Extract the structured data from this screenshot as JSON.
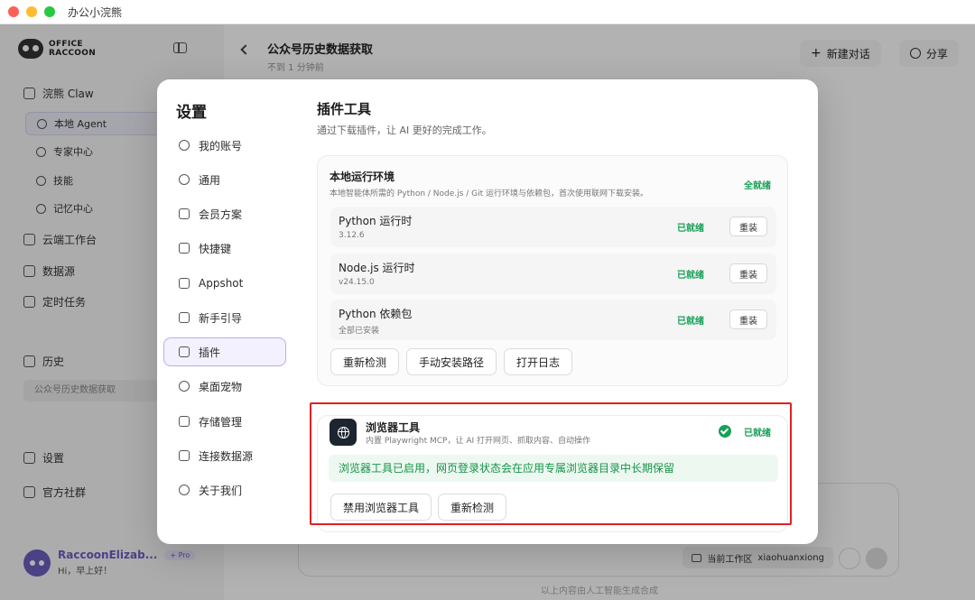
{
  "app": {
    "title": "办公小浣熊"
  },
  "sidebar": {
    "logo_line1": "OFFICE",
    "logo_line2": "RACCOON",
    "items": [
      {
        "label": "浣熊 Claw"
      },
      {
        "label": "本地 Agent"
      },
      {
        "label": "专家中心"
      },
      {
        "label": "技能"
      },
      {
        "label": "记忆中心"
      },
      {
        "label": "云端工作台"
      },
      {
        "label": "数据源"
      },
      {
        "label": "定时任务"
      },
      {
        "label": "历史"
      },
      {
        "label": "设置"
      },
      {
        "label": "官方社群"
      }
    ],
    "history_entry": "公众号历史数据获取",
    "user": {
      "name": "RaccoonElizab...",
      "badge": "+ Pro",
      "greeting": "Hi，早上好！"
    }
  },
  "header": {
    "title": "公众号历史数据获取",
    "subtitle": "不到 1 分钟前",
    "new_chat": "新建对话",
    "share": "分享"
  },
  "composer": {
    "workspace_label": "当前工作区",
    "workspace_name": "xiaohuanxiong"
  },
  "footer_note": "以上内容由人工智能生成合成",
  "settings": {
    "title": "设置",
    "menu": [
      {
        "label": "我的账号"
      },
      {
        "label": "通用"
      },
      {
        "label": "会员方案"
      },
      {
        "label": "快捷键"
      },
      {
        "label": "Appshot"
      },
      {
        "label": "新手引导"
      },
      {
        "label": "插件"
      },
      {
        "label": "桌面宠物"
      },
      {
        "label": "存储管理"
      },
      {
        "label": "连接数据源"
      },
      {
        "label": "关于我们"
      }
    ],
    "active_menu": "插件"
  },
  "plugins": {
    "title": "插件工具",
    "description": "通过下载插件，让 AI 更好的完成工作。",
    "env": {
      "title": "本地运行环境",
      "description": "本地智能体所需的 Python / Node.js / Git 运行环境与依赖包，首次使用联网下载安装。",
      "status": "全就绪",
      "runtimes": [
        {
          "name": "Python 运行时",
          "version": "3.12.6",
          "status": "已就绪",
          "action": "重装"
        },
        {
          "name": "Node.js 运行时",
          "version": "v24.15.0",
          "status": "已就绪",
          "action": "重装"
        },
        {
          "name": "Python 依赖包",
          "version": "全部已安装",
          "status": "已就绪",
          "action": "重装"
        }
      ],
      "actions": [
        "重新检测",
        "手动安装路径",
        "打开日志"
      ]
    },
    "browser": {
      "name": "浏览器工具",
      "description": "内置 Playwright MCP，让 AI 打开网页、抓取内容、自动操作",
      "status": "已就绪",
      "notice": "浏览器工具已启用，网页登录状态会在应用专属浏览器目录中长期保留",
      "actions": [
        "禁用浏览器工具",
        "重新检测"
      ]
    }
  },
  "colors": {
    "ready": "#18a058",
    "accent": "#6a5ec4",
    "highlight": "#e02020"
  }
}
